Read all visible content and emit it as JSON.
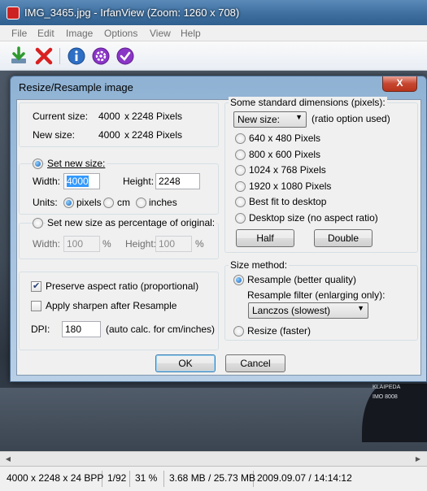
{
  "window": {
    "title": "IMG_3465.jpg - IrfanView (Zoom: 1260 x 708)"
  },
  "menu": [
    "File",
    "Edit",
    "Image",
    "Options",
    "View",
    "Help"
  ],
  "toolbar": [
    {
      "name": "save-icon",
      "label": "Save"
    },
    {
      "name": "delete-icon",
      "label": "Delete"
    },
    {
      "name": "info-icon",
      "label": "Info"
    },
    {
      "name": "settings-icon",
      "label": "Settings"
    },
    {
      "name": "about-icon",
      "label": "About"
    }
  ],
  "dialog": {
    "title": "Resize/Resample image",
    "close_label": "X",
    "current_size_label": "Current size:",
    "current_w": "4000",
    "current_x": "x",
    "current_h": "2248",
    "current_unit": "Pixels",
    "new_size_label": "New size:",
    "new_w": "4000",
    "new_x": "x",
    "new_h": "2248",
    "new_unit": "Pixels",
    "set_new_size_label": "Set new size:",
    "width_label": "Width:",
    "width_value": "4000",
    "height_label": "Height:",
    "height_value": "2248",
    "units_label": "Units:",
    "unit_pixels": "pixels",
    "unit_cm": "cm",
    "unit_inches": "inches",
    "percent_label": "Set new size as percentage of original:",
    "pct_width_label": "Width:",
    "pct_width_value": "100",
    "pct_height_label": "Height:",
    "pct_height_value": "100",
    "pct_sign": "%",
    "preserve_label": "Preserve aspect ratio (proportional)",
    "preserve_checked": true,
    "sharpen_label": "Apply sharpen after Resample",
    "sharpen_checked": false,
    "dpi_label": "DPI:",
    "dpi_value": "180",
    "dpi_note": "(auto calc. for cm/inches)",
    "std_dims_label": "Some standard dimensions (pixels):",
    "std_select_value": "New size:",
    "std_select_note": "(ratio option used)",
    "std_options": [
      "640 x 480 Pixels",
      "800 x 600 Pixels",
      "1024 x 768 Pixels",
      "1920 x 1080 Pixels",
      "Best fit to desktop",
      "Desktop size (no aspect ratio)"
    ],
    "half_label": "Half",
    "double_label": "Double",
    "method_label": "Size method:",
    "resample_label": "Resample (better quality)",
    "filter_label": "Resample filter (enlarging only):",
    "filter_value": "Lanczos (slowest)",
    "resize_label": "Resize (faster)",
    "ok_label": "OK",
    "cancel_label": "Cancel"
  },
  "photo": {
    "ship_name": "KLAIPEDA",
    "ship_imo": "IMO 8008"
  },
  "status": {
    "dimensions": "4000 x 2248 x 24 BPP",
    "index": "1/92",
    "zoom": "31 %",
    "memory": "3.68 MB / 25.73 MB",
    "datetime": "2009.09.07 / 14:14:12"
  }
}
